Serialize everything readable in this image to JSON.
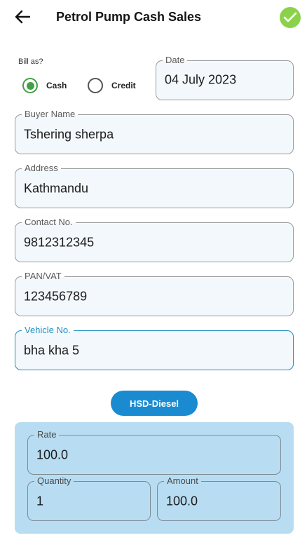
{
  "appbar": {
    "title": "Petrol Pump Cash Sales",
    "back_icon": "arrow-left-icon",
    "confirm_icon": "check-icon",
    "confirm_color": "#8bd24b"
  },
  "bill_as": {
    "label": "Bill as?",
    "options": [
      {
        "label": "Cash",
        "selected": true
      },
      {
        "label": "Credit",
        "selected": false
      }
    ]
  },
  "form": {
    "date": {
      "label": "Date",
      "value": "04 July 2023"
    },
    "buyer_name": {
      "label": "Buyer Name",
      "value": "Tshering sherpa"
    },
    "address": {
      "label": "Address",
      "value": "Kathmandu"
    },
    "contact": {
      "label": "Contact No.",
      "value": "9812312345"
    },
    "pan_vat": {
      "label": "PAN/VAT",
      "value": "123456789"
    },
    "vehicle": {
      "label": "Vehicle No.",
      "value": "bha kha 5"
    }
  },
  "fuel": {
    "button_label": "HSD-Diesel",
    "rate": {
      "label": "Rate",
      "value": "100.0"
    },
    "quantity": {
      "label": "Quantity",
      "value": "1"
    },
    "amount": {
      "label": "Amount",
      "value": "100.0"
    }
  },
  "colors": {
    "accent": "#1a8bd0",
    "focus": "#1e8fbf",
    "radio_selected": "#43a047",
    "panel_bg": "#b8ddf2"
  }
}
